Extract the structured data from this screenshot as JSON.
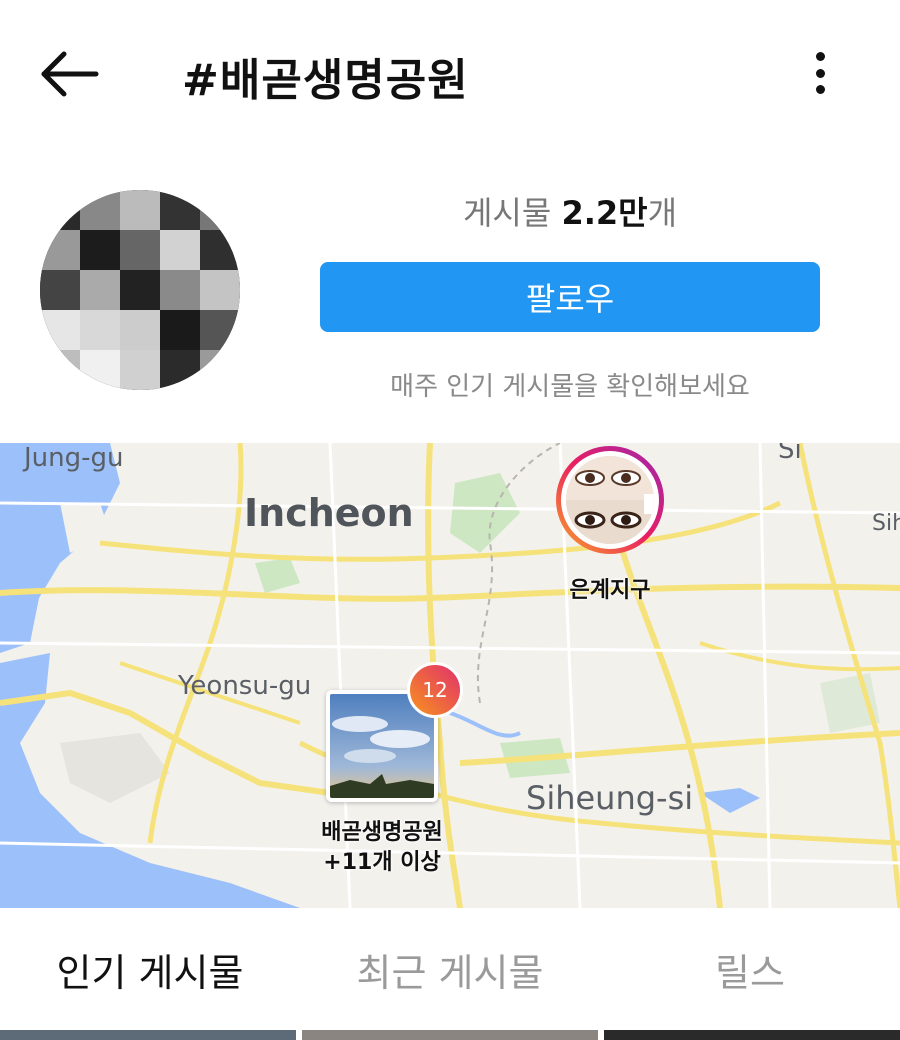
{
  "header": {
    "title": "#배곧생명공원"
  },
  "profile": {
    "post_label": "게시물 ",
    "post_value": "2.2만",
    "post_unit": "개",
    "follow_label": "팔로우",
    "weekly_text": "매주 인기 게시물을 확인해보세요"
  },
  "map": {
    "labels": {
      "junggu": "Jung-gu",
      "incheon": "Incheon",
      "yeonsu": "Yeonsu-gu",
      "siheung": "Siheung-si",
      "si": "Si",
      "sih": "Sih"
    },
    "story_pin": {
      "label": "은계지구"
    },
    "park_pin": {
      "badge": "12",
      "label_line1": "배곧생명공원",
      "label_line2": "+11개 이상"
    }
  },
  "tabs": [
    {
      "label": "인기 게시물",
      "active": true
    },
    {
      "label": "최근 게시물",
      "active": false
    },
    {
      "label": "릴스",
      "active": false
    }
  ],
  "colors": {
    "accent": "#2196f3",
    "map_water": "#9cc0f9",
    "map_road": "#f6e27a"
  }
}
